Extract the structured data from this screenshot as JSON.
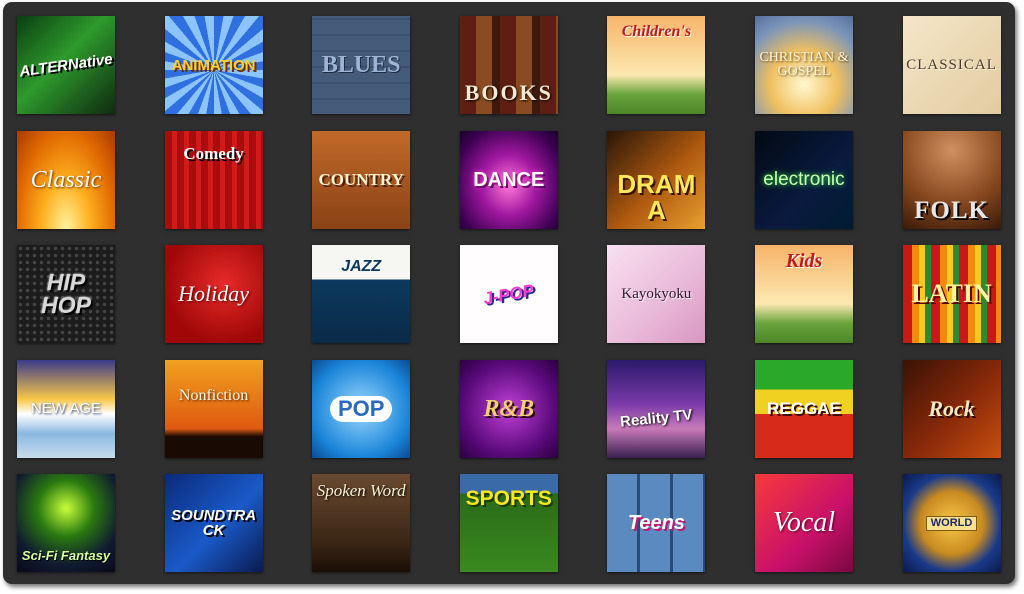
{
  "grid": {
    "tiles": [
      {
        "label": "ALTERNative",
        "icon": "alternative-genre-icon"
      },
      {
        "label": "ANIMATION",
        "icon": "animation-genre-icon"
      },
      {
        "label": "BLUES",
        "icon": "blues-genre-icon"
      },
      {
        "label": "BOOKS",
        "icon": "books-genre-icon"
      },
      {
        "label": "Children's",
        "icon": "childrens-genre-icon"
      },
      {
        "label": "CHRISTIAN & GOSPEL",
        "icon": "christian-gospel-genre-icon"
      },
      {
        "label": "CLASSICAL",
        "icon": "classical-genre-icon"
      },
      {
        "label": "Classic",
        "icon": "classic-genre-icon"
      },
      {
        "label": "Comedy",
        "icon": "comedy-genre-icon"
      },
      {
        "label": "COUNTRY",
        "icon": "country-genre-icon"
      },
      {
        "label": "DANCE",
        "icon": "dance-genre-icon"
      },
      {
        "label": "DRAMA",
        "icon": "drama-genre-icon"
      },
      {
        "label": "electronic",
        "icon": "electronic-genre-icon"
      },
      {
        "label": "FOLK",
        "icon": "folk-genre-icon"
      },
      {
        "label": "HIP HOP",
        "icon": "hip-hop-genre-icon"
      },
      {
        "label": "Holiday",
        "icon": "holiday-genre-icon"
      },
      {
        "label": "JAZZ",
        "icon": "jazz-genre-icon"
      },
      {
        "label": "J-POP",
        "icon": "j-pop-genre-icon"
      },
      {
        "label": "Kayokyoku",
        "icon": "kayokyoku-genre-icon"
      },
      {
        "label": "Kids",
        "icon": "kids-genre-icon"
      },
      {
        "label": "LATIN",
        "icon": "latin-genre-icon"
      },
      {
        "label": "NEW AGE",
        "icon": "new-age-genre-icon"
      },
      {
        "label": "Nonfiction",
        "icon": "nonfiction-genre-icon"
      },
      {
        "label": "POP",
        "icon": "pop-genre-icon"
      },
      {
        "label": "R&B",
        "icon": "rnb-genre-icon"
      },
      {
        "label": "Reality TV",
        "icon": "reality-tv-genre-icon"
      },
      {
        "label": "REGGAE",
        "icon": "reggae-genre-icon"
      },
      {
        "label": "Rock",
        "icon": "rock-genre-icon"
      },
      {
        "label": "Sci-Fi Fantasy",
        "icon": "sci-fi-fantasy-genre-icon"
      },
      {
        "label": "SOUNDTRACK",
        "icon": "soundtrack-genre-icon"
      },
      {
        "label": "Spoken Word",
        "icon": "spoken-word-genre-icon"
      },
      {
        "label": "SPORTS",
        "icon": "sports-genre-icon"
      },
      {
        "label": "Teens",
        "icon": "teens-genre-icon"
      },
      {
        "label": "Vocal",
        "icon": "vocal-genre-icon"
      },
      {
        "label": "WORLD",
        "icon": "world-genre-icon"
      }
    ]
  },
  "colors": {
    "frame_background": "#2f2f2f",
    "page_background": "#ffffff"
  }
}
